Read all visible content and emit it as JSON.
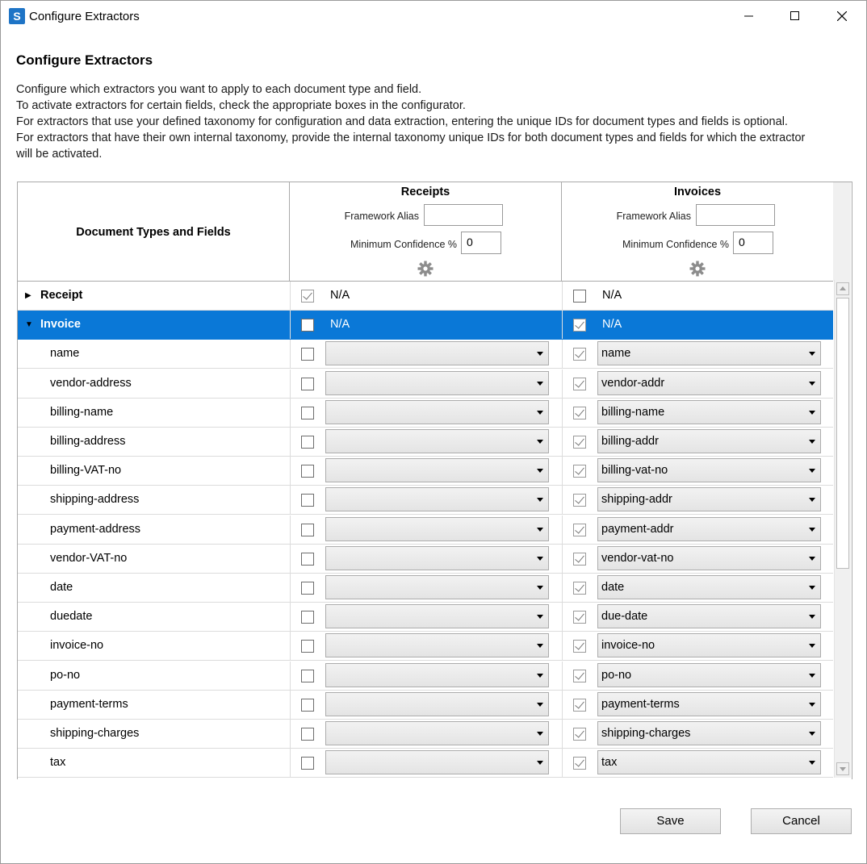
{
  "window": {
    "title": "Configure Extractors"
  },
  "dialog": {
    "heading": "Configure Extractors",
    "description": [
      "Configure which extractors you want to apply to each document type and field.",
      "To activate extractors for certain fields, check the appropriate boxes in the configurator.",
      "For extractors that use your defined taxonomy for configuration and data extraction, entering the unique IDs for document types and fields is optional.",
      "For extractors that have their own internal taxonomy, provide the internal taxonomy unique IDs for both document types and fields for which the extractor",
      "will be activated."
    ]
  },
  "grid": {
    "first_col_header": "Document Types and Fields",
    "extractors": [
      {
        "name": "Receipts",
        "framework_alias_label": "Framework Alias",
        "framework_alias_value": "",
        "min_conf_label": "Minimum Confidence %",
        "min_conf_value": "0"
      },
      {
        "name": "Invoices",
        "framework_alias_label": "Framework Alias",
        "framework_alias_value": "",
        "min_conf_label": "Minimum Confidence %",
        "min_conf_value": "0"
      }
    ],
    "rows": [
      {
        "type": "doc",
        "label": "Receipt",
        "expanded": false,
        "selected": false,
        "receipts_checked": true,
        "receipts_value": "N/A",
        "invoices_checked": false,
        "invoices_value": "N/A"
      },
      {
        "type": "doc",
        "label": "Invoice",
        "expanded": true,
        "selected": true,
        "receipts_checked": false,
        "receipts_value": "N/A",
        "invoices_checked": true,
        "invoices_value": "N/A"
      },
      {
        "type": "field",
        "label": "name",
        "receipts_checked": false,
        "receipts_value": "",
        "invoices_checked": true,
        "invoices_value": "name"
      },
      {
        "type": "field",
        "label": "vendor-address",
        "receipts_checked": false,
        "receipts_value": "",
        "invoices_checked": true,
        "invoices_value": "vendor-addr"
      },
      {
        "type": "field",
        "label": "billing-name",
        "receipts_checked": false,
        "receipts_value": "",
        "invoices_checked": true,
        "invoices_value": "billing-name"
      },
      {
        "type": "field",
        "label": "billing-address",
        "receipts_checked": false,
        "receipts_value": "",
        "invoices_checked": true,
        "invoices_value": "billing-addr"
      },
      {
        "type": "field",
        "label": "billing-VAT-no",
        "receipts_checked": false,
        "receipts_value": "",
        "invoices_checked": true,
        "invoices_value": "billing-vat-no"
      },
      {
        "type": "field",
        "label": "shipping-address",
        "receipts_checked": false,
        "receipts_value": "",
        "invoices_checked": true,
        "invoices_value": "shipping-addr"
      },
      {
        "type": "field",
        "label": "payment-address",
        "receipts_checked": false,
        "receipts_value": "",
        "invoices_checked": true,
        "invoices_value": "payment-addr"
      },
      {
        "type": "field",
        "label": "vendor-VAT-no",
        "receipts_checked": false,
        "receipts_value": "",
        "invoices_checked": true,
        "invoices_value": "vendor-vat-no"
      },
      {
        "type": "field",
        "label": "date",
        "receipts_checked": false,
        "receipts_value": "",
        "invoices_checked": true,
        "invoices_value": "date"
      },
      {
        "type": "field",
        "label": "duedate",
        "receipts_checked": false,
        "receipts_value": "",
        "invoices_checked": true,
        "invoices_value": "due-date"
      },
      {
        "type": "field",
        "label": "invoice-no",
        "receipts_checked": false,
        "receipts_value": "",
        "invoices_checked": true,
        "invoices_value": "invoice-no"
      },
      {
        "type": "field",
        "label": "po-no",
        "receipts_checked": false,
        "receipts_value": "",
        "invoices_checked": true,
        "invoices_value": "po-no"
      },
      {
        "type": "field",
        "label": "payment-terms",
        "receipts_checked": false,
        "receipts_value": "",
        "invoices_checked": true,
        "invoices_value": "payment-terms"
      },
      {
        "type": "field",
        "label": "shipping-charges",
        "receipts_checked": false,
        "receipts_value": "",
        "invoices_checked": true,
        "invoices_value": "shipping-charges"
      },
      {
        "type": "field",
        "label": "tax",
        "receipts_checked": false,
        "receipts_value": "",
        "invoices_checked": true,
        "invoices_value": "tax"
      }
    ]
  },
  "buttons": {
    "save": "Save",
    "cancel": "Cancel"
  },
  "colors": {
    "selection": "#0a78d7",
    "app_icon": "#1e74c6"
  }
}
